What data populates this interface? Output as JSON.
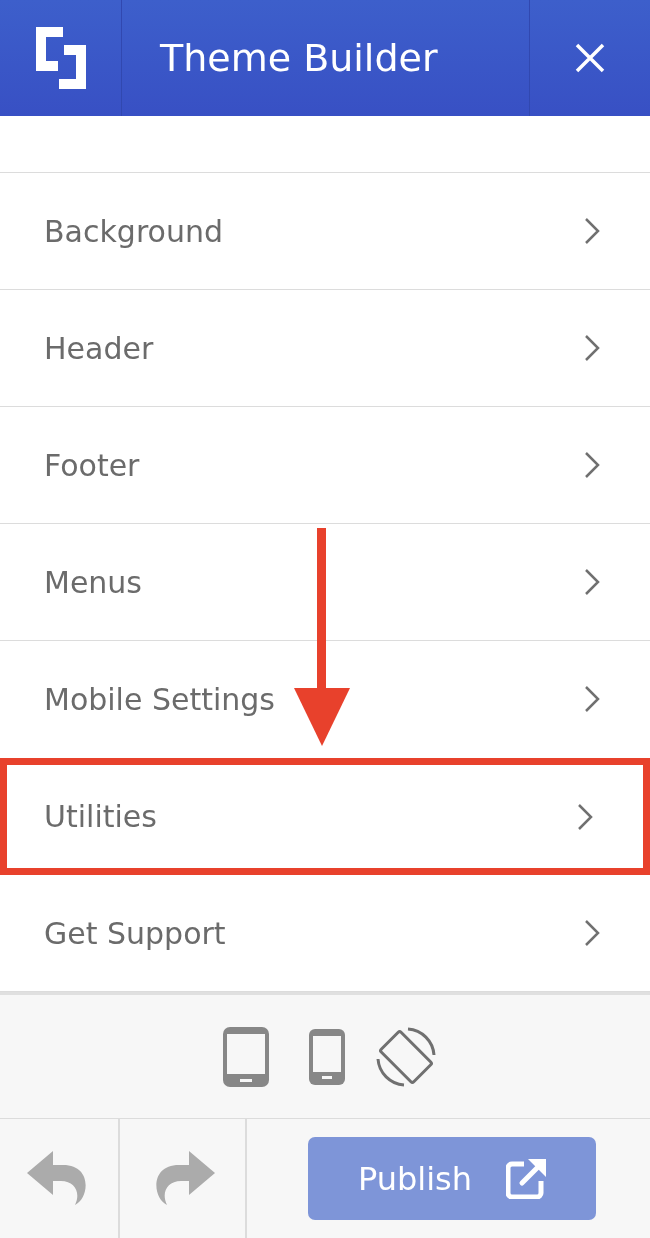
{
  "header": {
    "title": "Theme Builder"
  },
  "menu_items": [
    {
      "label": "Background",
      "highlighted": false
    },
    {
      "label": "Header",
      "highlighted": false
    },
    {
      "label": "Footer",
      "highlighted": false
    },
    {
      "label": "Menus",
      "highlighted": false
    },
    {
      "label": "Mobile Settings",
      "highlighted": false
    },
    {
      "label": "Utilities",
      "highlighted": true
    },
    {
      "label": "Get Support",
      "highlighted": false
    }
  ],
  "publish_button": {
    "label": "Publish"
  }
}
